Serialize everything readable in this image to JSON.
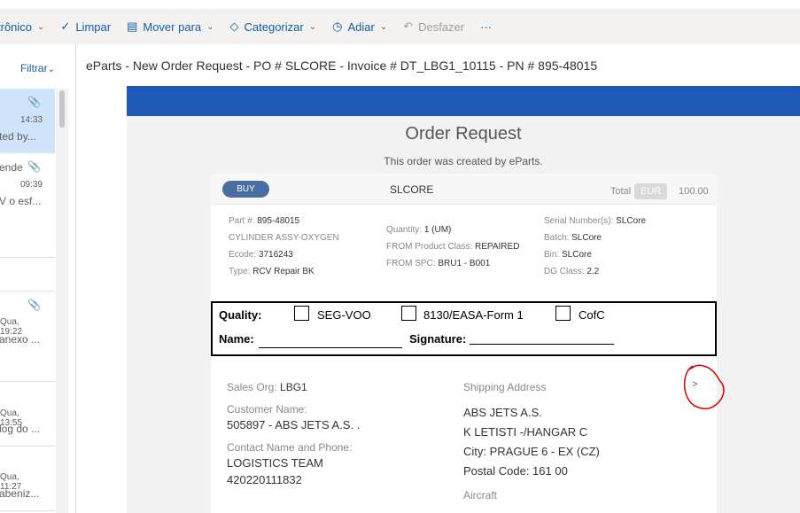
{
  "toolbar": {
    "items": [
      {
        "label": "trônico",
        "icon": "",
        "chevron": true
      },
      {
        "label": "Limpar",
        "icon": "broom-icon",
        "chevron": false
      },
      {
        "label": "Mover para",
        "icon": "move-folder-icon",
        "chevron": true
      },
      {
        "label": "Categorizar",
        "icon": "tag-icon",
        "chevron": true
      },
      {
        "label": "Adiar",
        "icon": "clock-icon",
        "chevron": true
      },
      {
        "label": "Desfazer",
        "icon": "undo-icon",
        "chevron": false
      },
      {
        "label": "···",
        "icon": "",
        "chevron": false
      }
    ]
  },
  "mail_list": {
    "filter_label": "Filtrar",
    "items": [
      {
        "time": "14:33",
        "preview": "ted by...",
        "attachment": true,
        "selected": true
      },
      {
        "sender": "ende",
        "time": "09:39",
        "preview": "V o esf...",
        "attachment": true
      },
      {
        "time": "Qua, 19:22",
        "preview": "anexo ...",
        "attachment": true
      },
      {
        "time": "Qua, 13:55",
        "preview": "log do ..."
      },
      {
        "time": "Qua, 11:27",
        "preview": "abeniz..."
      }
    ]
  },
  "reading_pane": {
    "subject": "eParts - New Order Request - PO # SLCORE - Invoice # DT_LBG1_10115 - PN # 895-48015"
  },
  "email": {
    "title": "Order Request",
    "subtitle": "This order was created by eParts.",
    "card": {
      "badge": "BUY",
      "po": "SLCORE",
      "total_label": "Total",
      "currency": "EUR",
      "amount": "100.00",
      "part_label": "Part #:",
      "part_value": "895-48015",
      "description": "CYLINDER ASSY-OXYGEN",
      "ecode_label": "Ecode:",
      "ecode_value": "3716243",
      "type_label": "Type:",
      "type_value": "RCV Repair BK",
      "quantity_label": "Quantity:",
      "quantity_value": "1 (UM)",
      "from_class_label": "FROM Product Class:",
      "from_class_value": "REPAIRED",
      "from_spc_label": "FROM SPC:",
      "from_spc_value": "BRU1 - B001",
      "serial_label": "Serial Number(s):",
      "serial_value": "SLCore",
      "batch_label": "Batch:",
      "batch_value": "SLCore",
      "bin_label": "Bin:",
      "bin_value": "SLCore",
      "dg_label": "DG Class:",
      "dg_value": "2.2"
    },
    "quality_box": {
      "quality_label": "Quality:",
      "options": [
        "SEG-VOO",
        "8130/EASA-Form 1",
        "CofC"
      ],
      "name_label": "Name:",
      "signature_label": "Signature:"
    },
    "sales": {
      "org_label": "Sales Org:",
      "org_value": "LBG1",
      "customer_label": "Customer Name:",
      "customer_value": "505897 - ABS JETS A.S. .",
      "contact_label": "Contact Name and Phone:",
      "contact_name": "LOGISTICS TEAM",
      "contact_phone": "420220111832"
    },
    "shipping": {
      "label": "Shipping Address",
      "lines": [
        "ABS JETS A.S.",
        "K LETISTI -/HANGAR C",
        "City: PRAGUE 6 - EX (CZ)",
        "Postal Code: 161 00"
      ],
      "aircraft_label": "Aircraft"
    },
    "arrow": ">"
  },
  "colors": {
    "accent": "#0f5ea8",
    "email_banner": "#1f59b7",
    "buy_badge": "#4a6da4",
    "annotation": "#e00000"
  }
}
